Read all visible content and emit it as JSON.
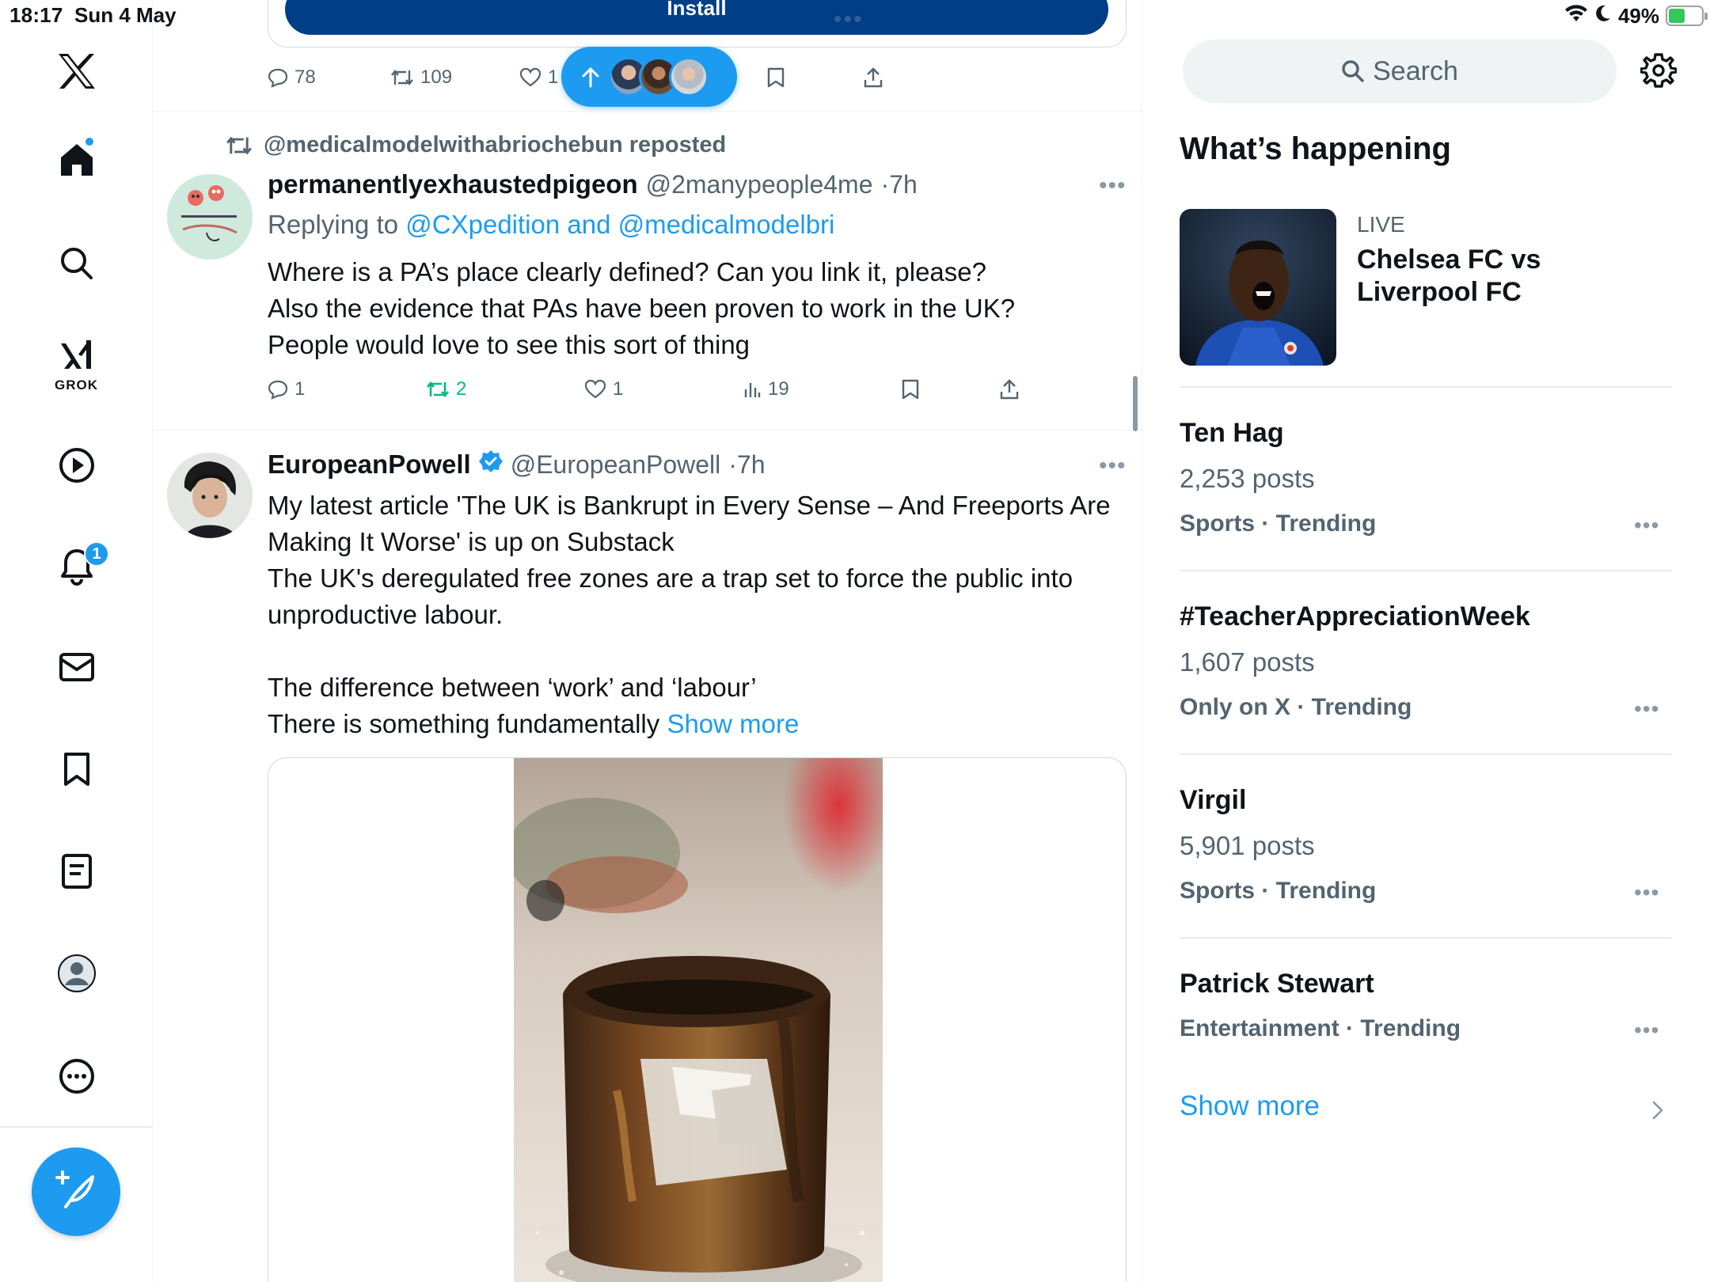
{
  "status_bar": {
    "time": "18:17",
    "date": "Sun 4 May",
    "battery": "49%",
    "battery_level": 0.49
  },
  "nav": {
    "items": [
      "x-logo",
      "home",
      "search",
      "grok",
      "videos",
      "notifications",
      "messages",
      "bookmarks",
      "lists",
      "profile",
      "more"
    ],
    "grok_label": "GROK",
    "notification_count": "1"
  },
  "feed": {
    "install_label": "Install",
    "ad_actions": {
      "replies": "78",
      "reposts": "109",
      "likes": "1"
    },
    "reply_post": {
      "reposted_by": "@medicalmodelwithabriochebun reposted",
      "name": "permanentlyexhaustedpigeon",
      "handle": "@2manypeople4me",
      "time": "7h",
      "replying_prefix": "Replying to ",
      "replying_to": "@CXpedition and @medicalmodelbri",
      "text": "Where is a PA’s place clearly defined? Can you link it, please?\nAlso the evidence that PAs have been proven to work in the UK?\nPeople would love to see this sort of thing",
      "replies": "1",
      "reposts": "2",
      "likes": "1",
      "views": "19"
    },
    "article_post": {
      "name": "EuropeanPowell",
      "handle": "@EuropeanPowell",
      "time": "7h",
      "text": "My latest article 'The UK is Bankrupt in Every Sense – And Freeports Are Making It Worse' is up on Substack\nThe UK's deregulated free zones are a trap set to force the public into unproductive labour.\n\nThe difference between ‘work’ and ‘labour’\nThere is something fundamentally ",
      "show_more": "Show more"
    }
  },
  "sidebar": {
    "search_placeholder": "Search",
    "title": "What’s happening",
    "live": {
      "tag": "LIVE",
      "title": "Chelsea FC vs Liverpool FC"
    },
    "trends": [
      {
        "name": "Ten Hag",
        "count": "2,253 posts",
        "category": "Sports · Trending"
      },
      {
        "name": "#TeacherAppreciationWeek",
        "count": "1,607 posts",
        "category": "Only on X · Trending"
      },
      {
        "name": "Virgil",
        "count": "5,901 posts",
        "category": "Sports · Trending"
      },
      {
        "name": "Patrick Stewart",
        "count": "",
        "category": "Entertainment · Trending"
      }
    ],
    "show_more": "Show more"
  }
}
